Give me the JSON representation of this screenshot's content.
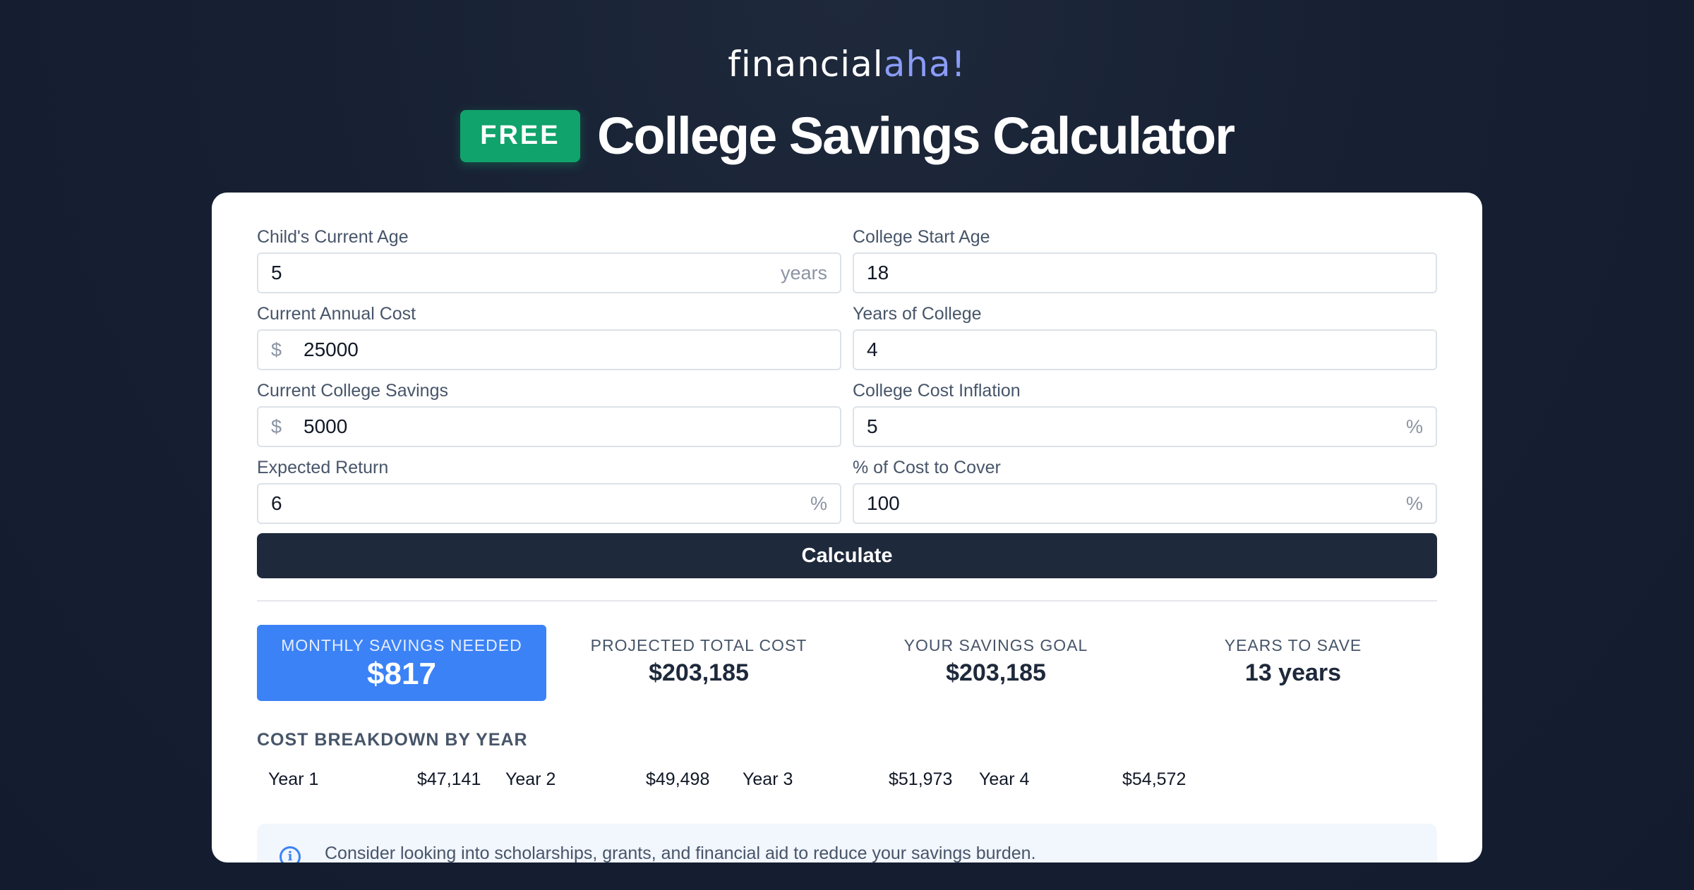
{
  "brand": {
    "part1": "financial",
    "part2": "aha!"
  },
  "header": {
    "badge": "FREE",
    "title": "College Savings Calculator"
  },
  "form": {
    "child_age": {
      "label": "Child's Current Age",
      "value": "5",
      "suffix": "years"
    },
    "start_age": {
      "label": "College Start Age",
      "value": "18"
    },
    "annual_cost": {
      "label": "Current Annual Cost",
      "prefix": "$",
      "value": "25000"
    },
    "years_college": {
      "label": "Years of College",
      "value": "4"
    },
    "savings": {
      "label": "Current College Savings",
      "prefix": "$",
      "value": "5000"
    },
    "inflation": {
      "label": "College Cost Inflation",
      "value": "5",
      "suffix": "%"
    },
    "return": {
      "label": "Expected Return",
      "value": "6",
      "suffix": "%"
    },
    "cover": {
      "label": "% of Cost to Cover",
      "value": "100",
      "suffix": "%"
    },
    "calculate_label": "Calculate"
  },
  "results": {
    "monthly": {
      "label": "MONTHLY SAVINGS NEEDED",
      "value": "$817"
    },
    "total_cost": {
      "label": "PROJECTED TOTAL COST",
      "value": "$203,185"
    },
    "goal": {
      "label": "YOUR SAVINGS GOAL",
      "value": "$203,185"
    },
    "years": {
      "label": "YEARS TO SAVE",
      "value": "13 years"
    }
  },
  "breakdown": {
    "title": "COST BREAKDOWN BY YEAR",
    "items": [
      {
        "label": "Year 1",
        "value": "$47,141"
      },
      {
        "label": "Year 2",
        "value": "$49,498"
      },
      {
        "label": "Year 3",
        "value": "$51,973"
      },
      {
        "label": "Year 4",
        "value": "$54,572"
      }
    ]
  },
  "tip": {
    "text": "Consider looking into scholarships, grants, and financial aid to reduce your savings burden."
  },
  "colors": {
    "accent": "#3b82f6",
    "badge": "#10a36b",
    "button": "#1e293b",
    "brand_highlight": "#8b9cf7"
  }
}
